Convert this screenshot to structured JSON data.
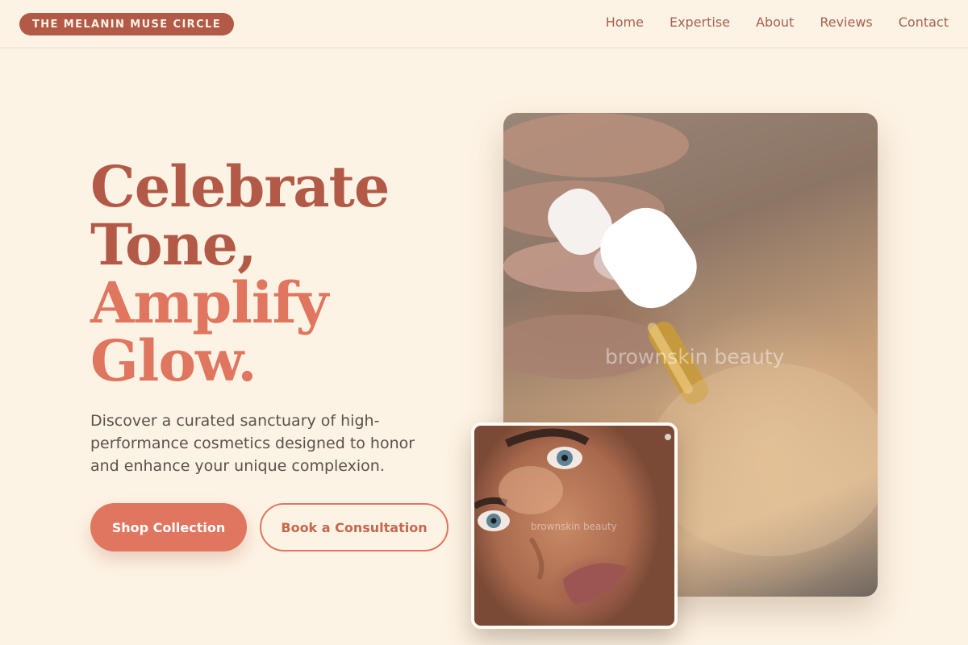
{
  "brand": {
    "name": "THE MELANIN MUSE CIRCLE"
  },
  "nav": {
    "items": [
      {
        "label": "Home"
      },
      {
        "label": "Expertise"
      },
      {
        "label": "About"
      },
      {
        "label": "Reviews"
      },
      {
        "label": "Contact"
      }
    ]
  },
  "hero": {
    "headline": {
      "line1": "Celebrate",
      "line2": "Tone,",
      "line3": "Amplify",
      "line4": "Glow."
    },
    "description": "Discover a curated sanctuary of high-performance cosmetics designed to honor and enhance your unique complexion.",
    "primary_cta": "Shop Collection",
    "secondary_cta": "Book a Consultation"
  },
  "images": {
    "main_watermark": "brownskin beauty",
    "inset_watermark": "brownskin beauty"
  },
  "colors": {
    "background": "#fdf3e4",
    "brand": "#b25a47",
    "accent": "#e0765f",
    "body_text": "#5b514c"
  }
}
